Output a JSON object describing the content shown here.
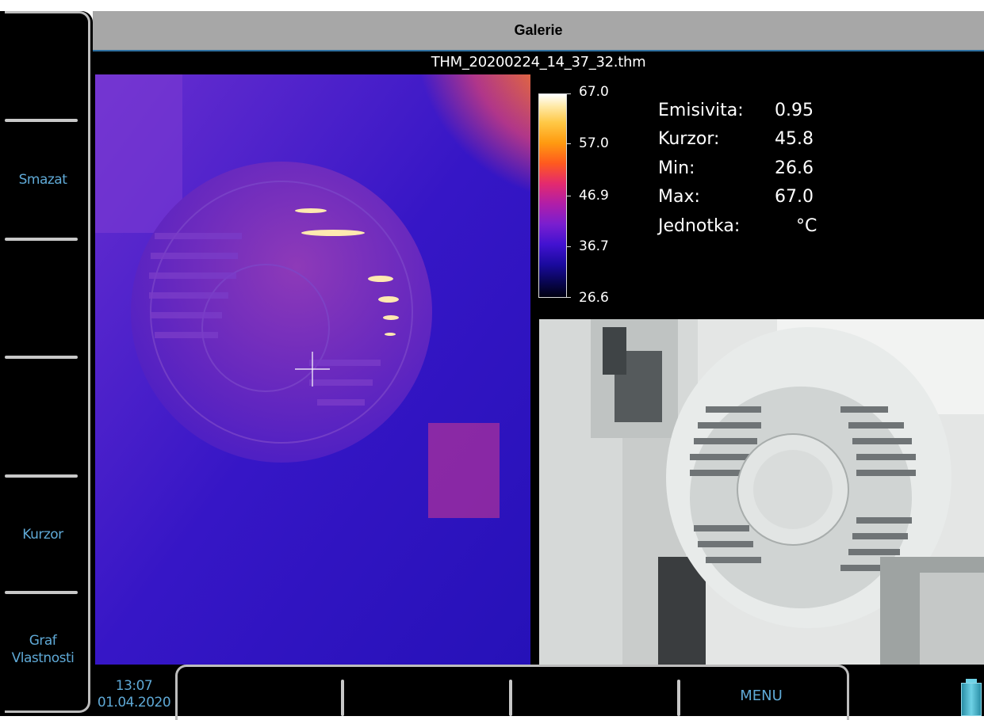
{
  "title": "Galerie",
  "filename": "THM_20200224_14_37_32.thm",
  "softkeys_left": [
    "",
    "Smazat",
    "",
    "",
    "Kurzor",
    "Graf\nVlastnosti"
  ],
  "softkeys_bottom": [
    "",
    "",
    "",
    "MENU"
  ],
  "datetime": {
    "time": "13:07",
    "date": "01.04.2020"
  },
  "scale": {
    "ticks": [
      "67.0",
      "57.0",
      "46.9",
      "36.7",
      "26.6"
    ],
    "colors": [
      "#ffffff",
      "#ffc845",
      "#ff9a10",
      "#e42a6e",
      "#7a1ecf",
      "#1a0a9e",
      "#000010"
    ]
  },
  "stats": [
    {
      "label": "Emisivita:",
      "value": "0.95"
    },
    {
      "label": "Kurzor:",
      "value": "45.8"
    },
    {
      "label": "Min:",
      "value": "26.6"
    },
    {
      "label": "Max:",
      "value": "67.0"
    },
    {
      "label": "Jednotka:",
      "value": "°C"
    }
  ],
  "icons": {
    "crosshair": "crosshair-icon",
    "battery": "battery-icon"
  },
  "colors": {
    "accent": "#5fa9d6",
    "title_bar": "#a7a7a7",
    "background": "#000000"
  }
}
